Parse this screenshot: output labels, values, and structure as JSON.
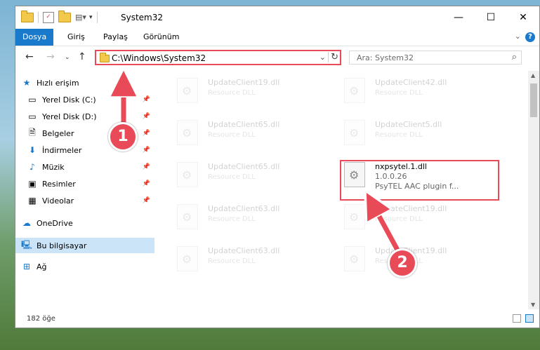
{
  "window": {
    "title": "System32"
  },
  "ribbon": {
    "tabs": [
      "Dosya",
      "Giriş",
      "Paylaş",
      "Görünüm"
    ]
  },
  "address": {
    "path": "C:\\Windows\\System32",
    "search_placeholder": "Ara: System32"
  },
  "sidebar": {
    "quick_access": "Hızlı erişim",
    "items": [
      {
        "label": "Yerel Disk (C:)",
        "icon": "drive-icon",
        "pinned": true
      },
      {
        "label": "Yerel Disk (D:)",
        "icon": "drive-icon",
        "pinned": true
      },
      {
        "label": "Belgeler",
        "icon": "documents-icon",
        "pinned": true
      },
      {
        "label": "İndirmeler",
        "icon": "download-icon",
        "pinned": true
      },
      {
        "label": "Müzik",
        "icon": "music-icon",
        "pinned": true
      },
      {
        "label": "Resimler",
        "icon": "pictures-icon",
        "pinned": true
      },
      {
        "label": "Videolar",
        "icon": "videos-icon",
        "pinned": true
      }
    ],
    "onedrive": "OneDrive",
    "this_pc": "Bu bilgisayar",
    "network": "Ağ"
  },
  "files": [
    {
      "name": "UpdateClient19.dll",
      "type": "Resource DLL"
    },
    {
      "name": "UpdateClient42.dll",
      "type": "Resource DLL"
    },
    {
      "name": "UpdateClient65.dll",
      "type": "Resource DLL"
    },
    {
      "name": "UpdateClient5.dll",
      "type": "Resource DLL"
    },
    {
      "name": "UpdateClient65.dll",
      "type": "Resource DLL"
    },
    {
      "name": "UpdateClient63.dll",
      "type": "Resource DLL"
    },
    {
      "name": "UpdateClient19.dll",
      "type": "Resource DLL"
    },
    {
      "name": "UpdateClient63.dll",
      "type": "Resource DLL"
    },
    {
      "name": "UpdateClient19.dll",
      "type": "Resource DLL"
    }
  ],
  "highlighted_file": {
    "name": "nxpsytel.1.dll",
    "version": "1.0.0.26",
    "description": "PsyTEL AAC plugin f..."
  },
  "status": {
    "count": "182 öğe"
  },
  "callouts": {
    "one": "1",
    "two": "2"
  },
  "colors": {
    "accent": "#1979ca",
    "highlight": "#e84b57"
  }
}
